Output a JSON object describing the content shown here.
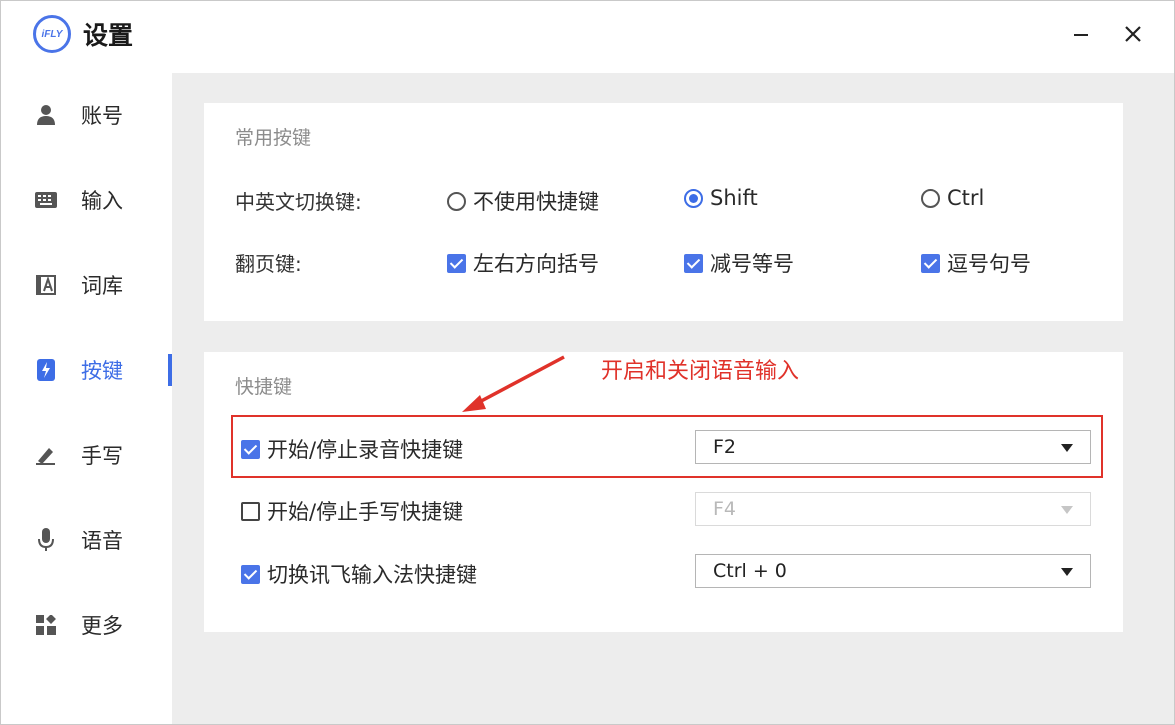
{
  "app": {
    "title": "设置",
    "logo_text": "iFLY",
    "accent": "#3d6de6"
  },
  "sidebar": {
    "items": [
      {
        "label": "账号",
        "icon": "user-icon"
      },
      {
        "label": "输入",
        "icon": "keyboard-icon"
      },
      {
        "label": "词库",
        "icon": "dictionary-icon"
      },
      {
        "label": "按键",
        "icon": "key-bolt-icon",
        "active": true
      },
      {
        "label": "手写",
        "icon": "pen-icon"
      },
      {
        "label": "语音",
        "icon": "microphone-icon"
      },
      {
        "label": "更多",
        "icon": "more-grid-icon"
      }
    ]
  },
  "window_controls": {
    "minimize": "minimize-icon",
    "close": "close-icon"
  },
  "common_keys": {
    "title": "常用按键",
    "switch": {
      "label": "中英文切换键:",
      "options": [
        {
          "label": "不使用快捷键",
          "selected": false
        },
        {
          "label": "Shift",
          "selected": true
        },
        {
          "label": "Ctrl",
          "selected": false
        }
      ]
    },
    "page": {
      "label": "翻页键:",
      "options": [
        {
          "label": "左右方向括号",
          "checked": true
        },
        {
          "label": "减号等号",
          "checked": true
        },
        {
          "label": "逗号句号",
          "checked": true
        }
      ]
    }
  },
  "shortcuts": {
    "title": "快捷键",
    "items": [
      {
        "label": "开始/停止录音快捷键",
        "checked": true,
        "value": "F2",
        "disabled": false
      },
      {
        "label": "开始/停止手写快捷键",
        "checked": false,
        "value": "F4",
        "disabled": true
      },
      {
        "label": "切换讯飞输入法快捷键",
        "checked": true,
        "value": "Ctrl + 0",
        "disabled": false
      }
    ]
  },
  "annotation": {
    "text": "开启和关闭语音输入",
    "color": "#e0322a"
  }
}
